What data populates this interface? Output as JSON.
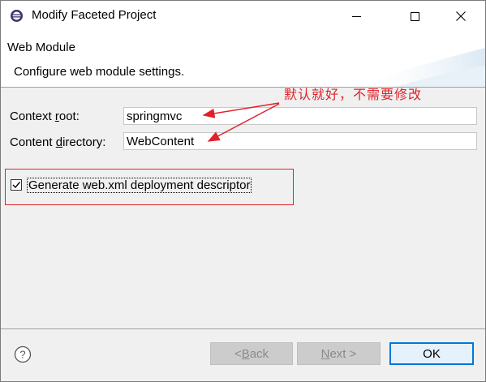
{
  "window": {
    "title": "Modify Faceted Project"
  },
  "banner": {
    "title": "Web Module",
    "description": "Configure web module settings."
  },
  "form": {
    "context_root": {
      "label_pre": "Context ",
      "label_accel": "r",
      "label_post": "oot:",
      "value": "springmvc"
    },
    "content_directory": {
      "label_pre": "Content ",
      "label_accel": "d",
      "label_post": "irectory:",
      "value": "WebContent"
    },
    "generate_webxml": {
      "label": "Generate web.xml deployment descriptor",
      "checked": true
    }
  },
  "annotation": {
    "text": "默认就好，不需要修改",
    "color": "#e0222a"
  },
  "buttons": {
    "back": {
      "pre": "< ",
      "accel": "B",
      "post": "ack"
    },
    "next": {
      "accel": "N",
      "post": "ext >"
    },
    "ok": "OK"
  },
  "icons": [
    "eclipse-icon",
    "minimize-icon",
    "maximize-icon",
    "close-icon",
    "help-icon",
    "checkmark-icon"
  ]
}
